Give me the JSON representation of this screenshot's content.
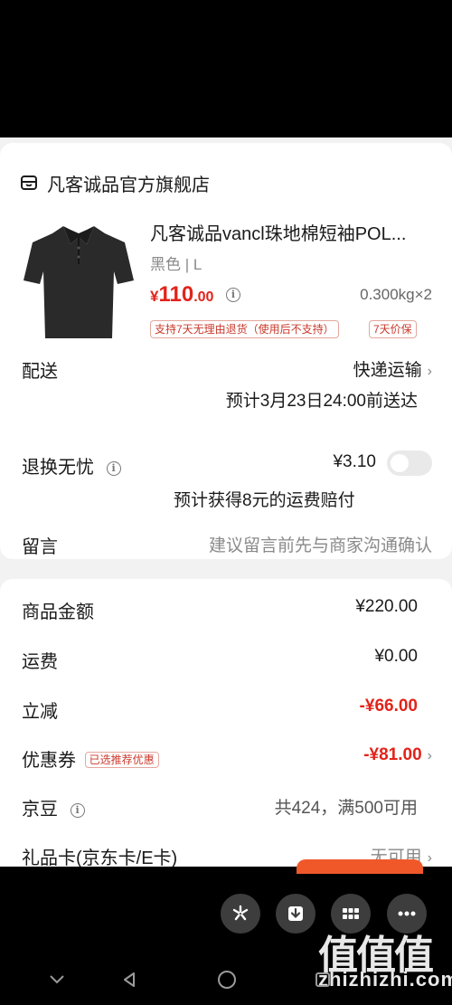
{
  "shop": {
    "icon": "store-icon",
    "name": "凡客诚品官方旗舰店"
  },
  "product": {
    "title": "凡客诚品vancl珠地棉短袖POL...",
    "spec": "黑色 | L",
    "price_currency": "¥",
    "price_int": "110",
    "price_dec": ".00",
    "weight": "0.300kg×2",
    "tag_return": "支持7天无理由退货（使用后不支持）",
    "tag_protect": "7天价保"
  },
  "delivery": {
    "label": "配送",
    "method": "快递运输",
    "eta": "预计3月23日24:00前送达"
  },
  "return_insurance": {
    "label": "退换无忧",
    "price": "¥3.10",
    "note": "预计获得8元的运费赔付",
    "enabled": false
  },
  "message": {
    "label": "留言",
    "placeholder": "建议留言前先与商家沟通确认"
  },
  "summary": {
    "goods_label": "商品金额",
    "goods_value": "¥220.00",
    "shipping_label": "运费",
    "shipping_value": "¥0.00",
    "discount_label": "立减",
    "discount_value": "-¥66.00",
    "coupon_label": "优惠券",
    "coupon_tag": "已选推荐优惠",
    "coupon_value": "-¥81.00",
    "jingdou_label": "京豆",
    "jingdou_value": "共424，满500可用",
    "giftcard_label": "礼品卡(京东卡/E卡)",
    "giftcard_value": "无可用"
  },
  "floating_actions": [
    "pinwheel-icon",
    "download-icon",
    "grid-icon",
    "more-icon"
  ],
  "system_nav": [
    "back-chevron-icon",
    "back-triangle-icon",
    "home-circle-icon",
    "recents-square-icon"
  ],
  "watermark": {
    "main": "值值值",
    "sub": "zhizhizhi.com"
  },
  "colors": {
    "accent": "#e2231a",
    "tag_border": "#e4a79d",
    "background": "#f2f2f2"
  }
}
